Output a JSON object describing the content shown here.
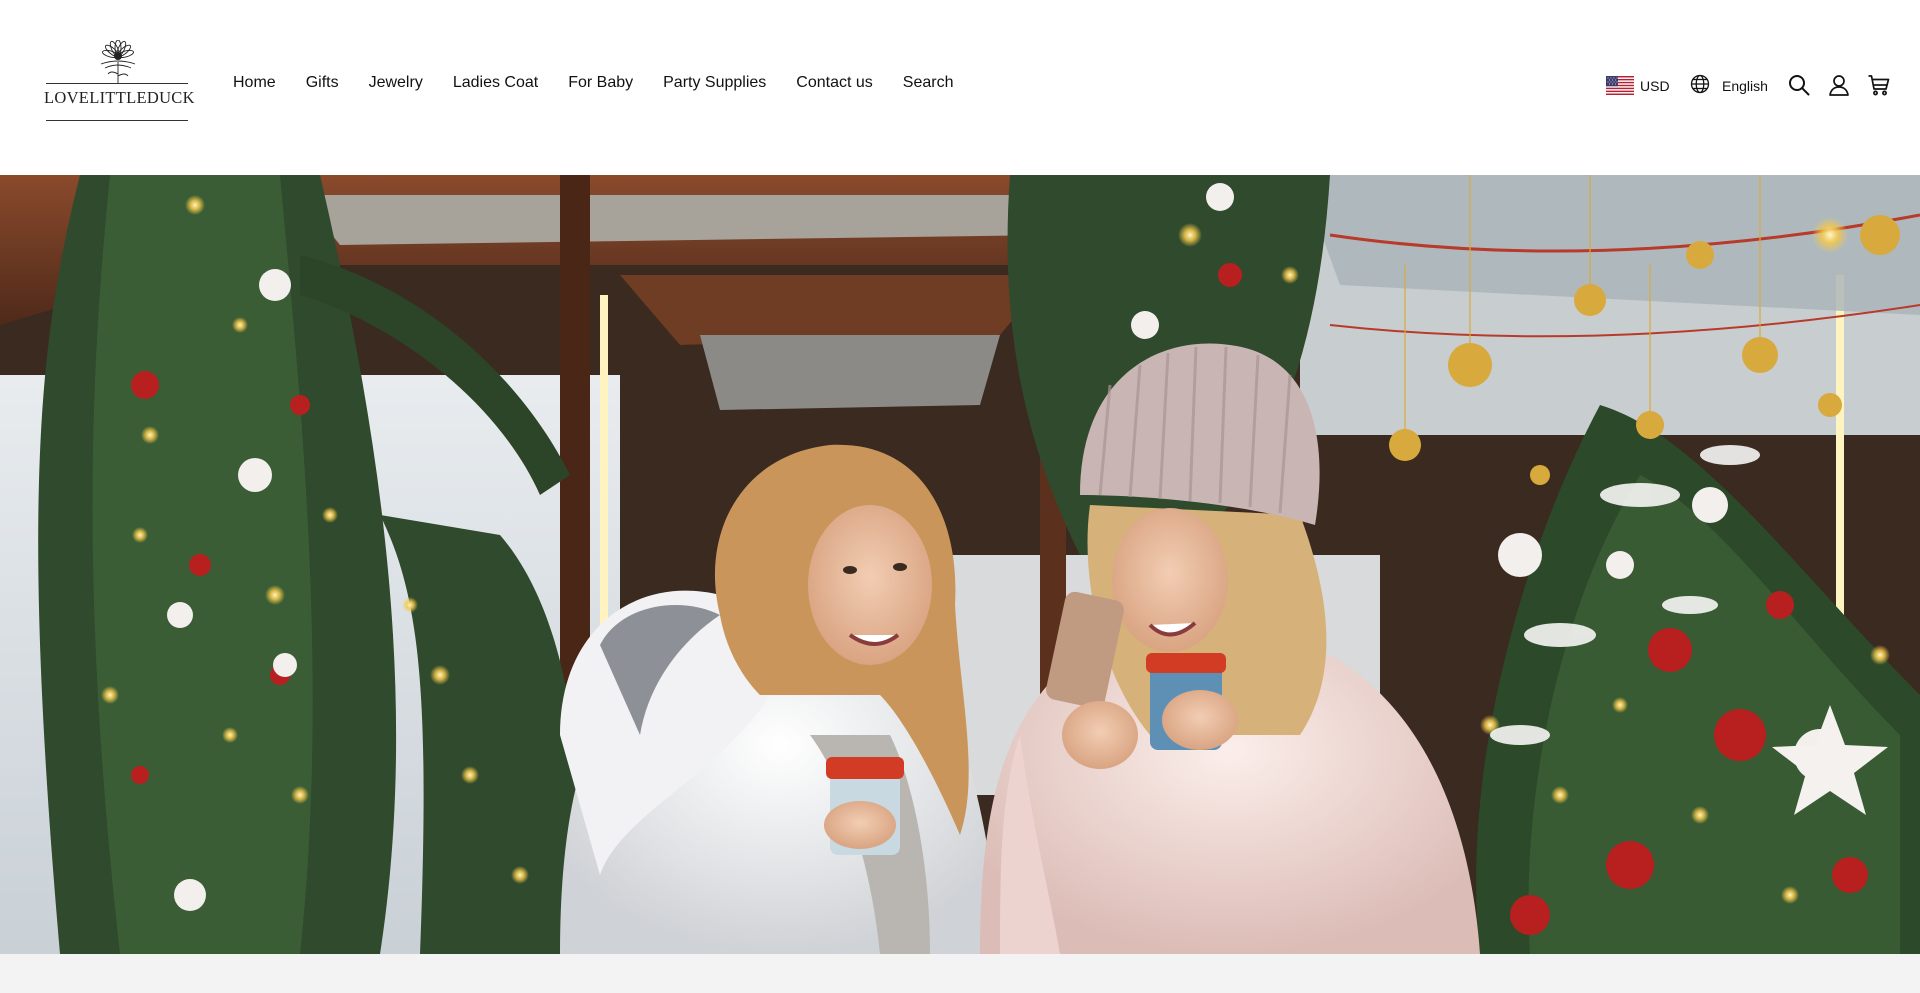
{
  "brand": {
    "name": "LOVELITTLEDUCK",
    "logo_icon": "daisy-flower-icon"
  },
  "nav": {
    "items": [
      {
        "label": "Home"
      },
      {
        "label": "Gifts"
      },
      {
        "label": "Jewelry"
      },
      {
        "label": "Ladies Coat"
      },
      {
        "label": "For Baby"
      },
      {
        "label": "Party Supplies"
      },
      {
        "label": "Contact us"
      },
      {
        "label": "Search"
      }
    ]
  },
  "localization": {
    "currency": {
      "label": "USD",
      "flag_icon": "us-flag-icon"
    },
    "language": {
      "label": "English",
      "icon": "globe-icon"
    }
  },
  "header_icons": [
    {
      "icon": "search-icon"
    },
    {
      "icon": "account-icon"
    },
    {
      "icon": "cart-icon"
    }
  ],
  "hero": {
    "image_content": "photo-banner",
    "colors": {
      "wood": "#6b3a24",
      "tree_green": "#2f4a2c",
      "light_gold": "#f5c84a",
      "ornament_red": "#b81f1f",
      "coat_white": "#ecebea",
      "coat_pink": "#f0d8d4",
      "hat": "#c9b6b4",
      "hair": "#c9955a",
      "sky": "#d7dde2"
    }
  },
  "theme": {
    "text": "#121212",
    "background": "#ffffff",
    "band": "#f3f3f3"
  }
}
